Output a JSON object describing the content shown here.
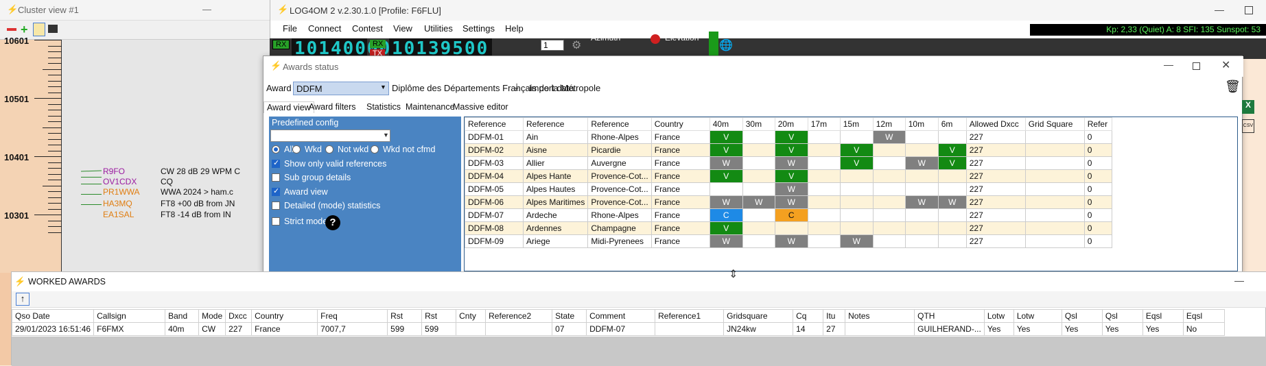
{
  "cluster": {
    "title": "Cluster view #1",
    "min_icon": "—",
    "freqs": [
      "10601",
      "10501",
      "10401",
      "10301"
    ],
    "spots": [
      {
        "call": "R9FO",
        "color": "#9a1aa0",
        "text": "CW 28 dB 29 WPM C"
      },
      {
        "call": "OV1CDX",
        "color": "#9a1aa0",
        "text": "CQ"
      },
      {
        "call": "PR1WWA",
        "color": "#e07d10",
        "text": "WWA 2024 > ham.c"
      },
      {
        "call": "HA3MQ",
        "color": "#e07d10",
        "text": "FT8 +00 dB from JN"
      },
      {
        "call": "EA1SAL",
        "color": "#e07d10",
        "text": "FT8 -14 dB from IN"
      }
    ]
  },
  "main": {
    "title": "LOG4OM 2 v.2.30.1.0 [Profile: F6FLU]",
    "menus": [
      "File",
      "Connect",
      "Contest",
      "View",
      "Utilities",
      "Settings",
      "Help"
    ],
    "kp": "Kp: 2,33 (Quiet)  A: 8  SFI: 135 Sunspot: 53",
    "rx_label": "RX",
    "vfo_a": "10140000",
    "vfo_b": "10139500",
    "rx2": "RX",
    "tx": "TX",
    "step": "1",
    "azimuth": "Azimuth",
    "elevation": "Elevation"
  },
  "awards": {
    "title": "Awards status",
    "award_label": "Award",
    "award_value": "DDFM",
    "award_desc": "Diplôme des Départements Français de la Métropole",
    "import": "Import data",
    "tabs": [
      "Award view",
      "Award filters",
      "Statistics",
      "Maintenance",
      "Massive editor"
    ],
    "predefined": "Predefined config",
    "radios": [
      "All",
      "Wkd",
      "Not wkd",
      "Wkd not cfmd"
    ],
    "checks": [
      {
        "label": "Show only valid references",
        "on": true
      },
      {
        "label": "Sub group details",
        "on": false
      },
      {
        "label": "Award view",
        "on": true
      },
      {
        "label": "Detailed (mode) statistics",
        "on": false
      },
      {
        "label": "Strict mode",
        "on": false
      }
    ],
    "help": "?",
    "columns": [
      "Reference",
      "Reference",
      "Reference",
      "Country",
      "40m",
      "30m",
      "20m",
      "17m",
      "15m",
      "12m",
      "10m",
      "6m",
      "Allowed Dxcc",
      "Grid Square",
      "Refer"
    ],
    "rows": [
      [
        "DDFM-01",
        "Ain",
        "Rhone-Alpes",
        "France",
        "V",
        "",
        "V",
        "",
        "",
        "W",
        "",
        "",
        "227",
        "",
        "0"
      ],
      [
        "DDFM-02",
        "Aisne",
        "Picardie",
        "France",
        "V",
        "",
        "V",
        "",
        "V",
        "",
        "",
        "V",
        "227",
        "",
        "0"
      ],
      [
        "DDFM-03",
        "Allier",
        "Auvergne",
        "France",
        "W",
        "",
        "W",
        "",
        "V",
        "",
        "W",
        "V",
        "227",
        "",
        "0"
      ],
      [
        "DDFM-04",
        "Alpes Hante",
        "Provence-Cot...",
        "France",
        "V",
        "",
        "V",
        "",
        "",
        "",
        "",
        "",
        "227",
        "",
        "0"
      ],
      [
        "DDFM-05",
        "Alpes Hautes",
        "Provence-Cot...",
        "France",
        "",
        "",
        "W",
        "",
        "",
        "",
        "",
        "",
        "227",
        "",
        "0"
      ],
      [
        "DDFM-06",
        "Alpes Maritimes",
        "Provence-Cot...",
        "France",
        "W",
        "W",
        "W",
        "",
        "",
        "",
        "W",
        "W",
        "227",
        "",
        "0"
      ],
      [
        "DDFM-07",
        "Ardeche",
        "Rhone-Alpes",
        "France",
        "C",
        "",
        "C",
        "",
        "",
        "",
        "",
        "",
        "227",
        "",
        "0"
      ],
      [
        "DDFM-08",
        "Ardennes",
        "Champagne",
        "France",
        "V",
        "",
        "",
        "",
        "",
        "",
        "",
        "",
        "227",
        "",
        "0"
      ],
      [
        "DDFM-09",
        "Ariege",
        "Midi-Pyrenees",
        "France",
        "W",
        "",
        "W",
        "",
        "W",
        "",
        "",
        "",
        "227",
        "",
        "0"
      ]
    ]
  },
  "worked": {
    "title": "WORKED AWARDS",
    "columns": [
      "Qso Date",
      "Callsign",
      "Band",
      "Mode",
      "Dxcc",
      "Country",
      "Freq",
      "Rst",
      "Rst",
      "Cnty",
      "Reference2",
      "State",
      "Comment",
      "Reference1",
      "Gridsquare",
      "Cq",
      "Itu",
      "Notes",
      "QTH",
      "Lotw",
      "Lotw",
      "Qsl",
      "Qsl",
      "Eqsl",
      "Eqsl"
    ],
    "rows": [
      [
        "29/01/2023 16:51:46",
        "F6FMX",
        "40m",
        "CW",
        "227",
        "France",
        "7007,7",
        "599",
        "599",
        "",
        "",
        "07",
        "DDFM-07",
        "",
        "JN24kw",
        "14",
        "27",
        "",
        "GUILHERAND-...",
        "Yes",
        "Yes",
        "Yes",
        "Yes",
        "Yes",
        "No"
      ]
    ]
  }
}
